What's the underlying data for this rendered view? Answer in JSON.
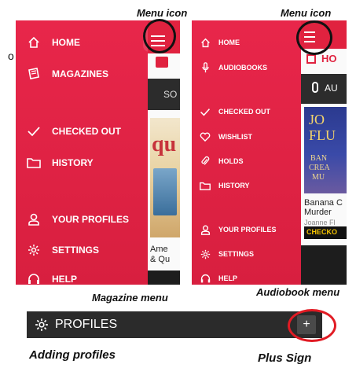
{
  "captions": {
    "menu_icon_left": "Menu icon",
    "menu_icon_right": "Menu icon",
    "magazine_menu": "Magazine menu",
    "audiobook_menu": "Audiobook menu",
    "adding_profiles": "Adding profiles",
    "plus_sign": "Plus Sign"
  },
  "left_label_fragment": "o",
  "magazine_menu": {
    "items": [
      {
        "label": "HOME",
        "icon": "home-icon"
      },
      {
        "label": "MAGAZINES",
        "icon": "magazine-icon"
      },
      {
        "label": "CHECKED OUT",
        "icon": "checkmark-icon"
      },
      {
        "label": "HISTORY",
        "icon": "folder-icon"
      },
      {
        "label": "YOUR PROFILES",
        "icon": "profile-icon"
      },
      {
        "label": "SETTINGS",
        "icon": "gear-icon"
      },
      {
        "label": "HELP",
        "icon": "headset-icon"
      }
    ],
    "background_strip": {
      "tab_fragment": "SO",
      "caption_line1": "Ame",
      "caption_line2": "& Qu",
      "cover_fragment": "qu"
    }
  },
  "audiobook_menu": {
    "items": [
      {
        "label": "HOME",
        "icon": "home-icon"
      },
      {
        "label": "AUDIOBOOKS",
        "icon": "microphone-icon"
      },
      {
        "label": "CHECKED OUT",
        "icon": "checkmark-icon"
      },
      {
        "label": "WISHLIST",
        "icon": "heart-icon"
      },
      {
        "label": "HOLDS",
        "icon": "paperclip-icon"
      },
      {
        "label": "HISTORY",
        "icon": "folder-icon"
      },
      {
        "label": "YOUR PROFILES",
        "icon": "profile-icon"
      },
      {
        "label": "SETTINGS",
        "icon": "gear-icon"
      },
      {
        "label": "HELP",
        "icon": "headset-icon"
      }
    ],
    "background_strip": {
      "header_fragment": "HO",
      "tab_fragment": "AU",
      "cover_line1": "JO",
      "cover_line2": "FLU",
      "cover_line3": "BAN",
      "cover_line4": "CREA",
      "cover_line5": "MU",
      "book_title1": "Banana C",
      "book_title2": "Murder",
      "book_author": "Joanne Fl",
      "button_fragment": "CHECKO"
    }
  },
  "profiles_bar": {
    "title": "PROFILES",
    "plus_label": "+"
  },
  "colors": {
    "menu_red": "#e0223f",
    "profiles_bar": "#2b2b2b",
    "highlight_ring_red": "#e11b24"
  }
}
